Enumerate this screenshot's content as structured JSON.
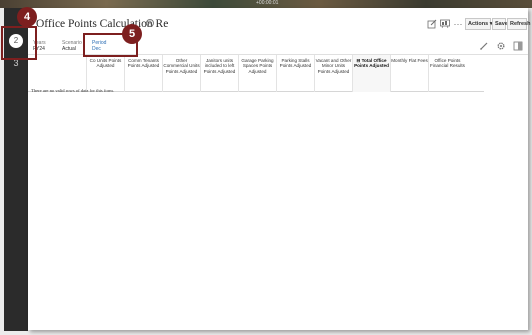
{
  "banner": {
    "text": "+00:00:01"
  },
  "form": {
    "title": "Office Points Calculation Re",
    "info_icon": "info-icon",
    "actions_label": "Actions ▾",
    "save_label": "Save",
    "refresh_label": "Refresh",
    "more_label": "···"
  },
  "pov": {
    "years_label": "Years",
    "years_value": "FY24",
    "scenario_label": "Scenario",
    "scenario_value": "Actual",
    "period_label": "Period",
    "period_value": "Dec"
  },
  "rail": {
    "step_current": "2",
    "step_next": "3"
  },
  "callouts": {
    "first": "4",
    "second": "5"
  },
  "grid": {
    "columns": [
      "Co Units Points Adjusted",
      "Comm Tenants Points Adjusted",
      "Other Commercial Units Points Adjusted",
      "Janitors units included to left Points Adjusted",
      "Garage Parking Spaces Points Adjusted",
      "Parking Stalls Points Adjusted",
      "Vacant and Other Minor Units Points Adjusted",
      "⊟ Total Office Points Adjusted",
      "Monthly Flat Fees",
      "Office Points Financial Results"
    ],
    "empty_message": "There are no valid rows of data for this form."
  },
  "icons": [
    "info-icon",
    "edit-icon",
    "chart-icon",
    "pencil-icon",
    "gear-icon",
    "layout-icon"
  ]
}
